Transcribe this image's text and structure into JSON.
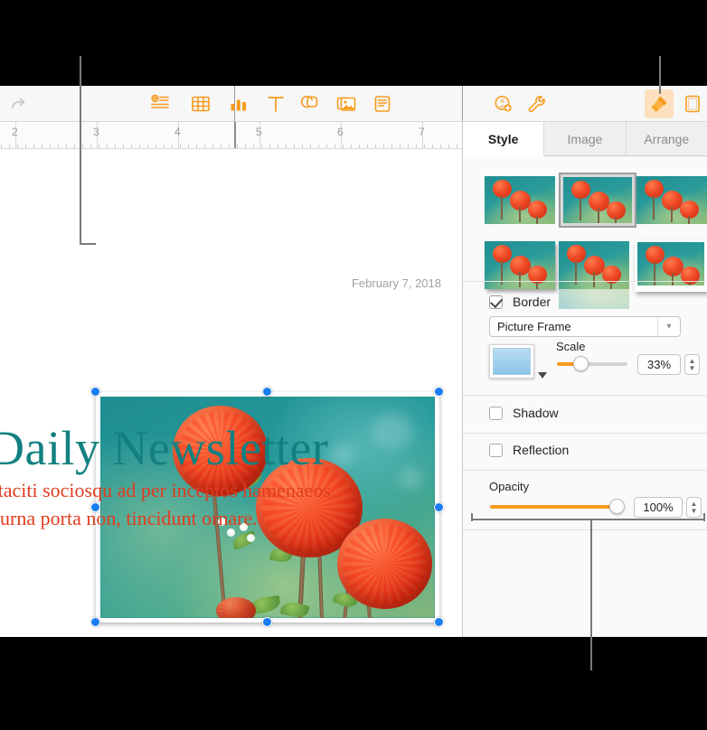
{
  "toolbar": {
    "redo_label": "Redo",
    "items": [
      {
        "name": "insert-list-button",
        "label": "Add Item"
      },
      {
        "name": "table-button",
        "label": "Table"
      },
      {
        "name": "chart-button",
        "label": "Chart"
      },
      {
        "name": "text-button",
        "label": "Text"
      },
      {
        "name": "shape-button",
        "label": "Shape"
      },
      {
        "name": "media-button",
        "label": "Media"
      },
      {
        "name": "comment-button",
        "label": "Comment"
      }
    ],
    "right_items": [
      {
        "name": "collaborate-button",
        "label": "Collaborate"
      },
      {
        "name": "settings-button",
        "label": "Settings"
      },
      {
        "name": "format-button",
        "label": "Format"
      },
      {
        "name": "document-button",
        "label": "Document"
      }
    ]
  },
  "ruler": {
    "marks": [
      "2",
      "3",
      "4",
      "5",
      "6",
      "7"
    ]
  },
  "document": {
    "date": "February 7, 2018",
    "headline": "Daily Newsletter",
    "body_line1": "t taciti sociosqu ad per inceptos hamenaeos.",
    "body_line2": "s urna porta non, tincidunt ornare."
  },
  "panel": {
    "tabs": [
      {
        "label": "Style",
        "active": true
      },
      {
        "label": "Image",
        "active": false
      },
      {
        "label": "Arrange",
        "active": false
      }
    ],
    "styles": [
      {
        "name": "style-plain-1",
        "selected": false
      },
      {
        "name": "style-gray-frame",
        "selected": true
      },
      {
        "name": "style-plain-2",
        "selected": false
      },
      {
        "name": "style-shadow",
        "selected": false
      },
      {
        "name": "style-reflection",
        "selected": false
      },
      {
        "name": "style-white-border",
        "selected": false
      }
    ],
    "border": {
      "label": "Border",
      "checked": true,
      "type_value": "Picture Frame",
      "scale_label": "Scale",
      "scale_value": "33%",
      "scale_percent": 33,
      "swatch_color": "#8cc6e8"
    },
    "shadow": {
      "label": "Shadow",
      "checked": false
    },
    "reflection": {
      "label": "Reflection",
      "checked": false
    },
    "opacity": {
      "label": "Opacity",
      "value": "100%",
      "percent": 100
    },
    "accent_color": "#f79b1e",
    "selection_color": "#1a7ef2"
  }
}
